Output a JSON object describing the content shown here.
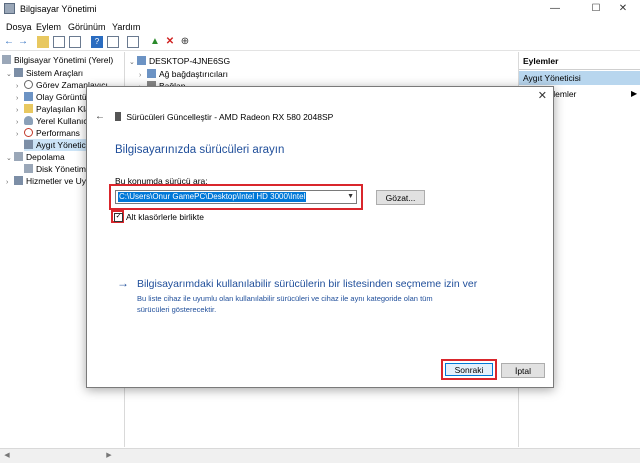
{
  "window": {
    "title": "Bilgisayar Yönetimi"
  },
  "menu": [
    "Dosya",
    "Eylem",
    "Görünüm",
    "Yardım"
  ],
  "tree": {
    "root": "Bilgisayar Yönetimi (Yerel)",
    "system_tools": "Sistem Araçları",
    "task_scheduler": "Görev Zamanlayıcı",
    "event_viewer": "Olay Görüntü",
    "shared_folders": "Paylaşılan Kla",
    "local_users": "Yerel Kullanıcı",
    "performance": "Performans",
    "device_manager": "Aygıt Yönetici",
    "storage": "Depolama",
    "disk_management": "Disk Yönetimi",
    "services": "Hizmetler ve Uyg"
  },
  "devices": {
    "computer": "DESKTOP-4JNE6SG",
    "network": "Ağ bağdaştırıcıları",
    "partial": "Bağlan"
  },
  "actions": {
    "header": "Eylemler",
    "selected": "Aygıt Yöneticisi",
    "more": "ylemler"
  },
  "dialog": {
    "header": "Sürücüleri Güncelleştir - AMD Radeon RX 580 2048SP",
    "heading": "Bilgisayarınızda sürücüleri arayın",
    "search_label": "Bu konumda sürücü ara:",
    "path_value": "C:\\Users\\Onur GamePC\\Desktop\\Intel HD 3000\\Intel",
    "browse_label": "Gözat...",
    "subfolders_label": "Alt klasörlerle birlikte",
    "subfolders_checked": true,
    "pick_title": "Bilgisayarımdaki kullanılabilir sürücülerin bir listesinden seçmeme izin ver",
    "pick_desc": "Bu liste cihaz ile uyumlu olan kullanılabilir sürücüleri ve cihaz ile aynı kategoride olan tüm sürücüleri gösterecektir.",
    "next_label": "Sonraki",
    "cancel_label": "İptal",
    "check_glyph": "✓"
  },
  "colors": {
    "accent": "#0078d7",
    "highlight": "#d9262c",
    "link": "#1f4e9a"
  }
}
